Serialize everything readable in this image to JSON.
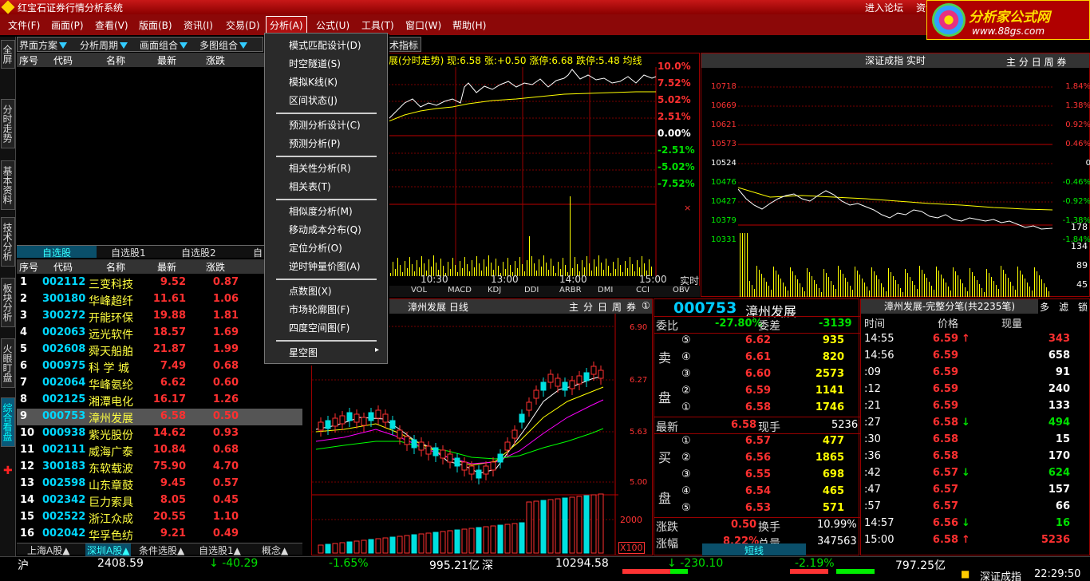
{
  "window": {
    "title": "红宝石证券行情分析系统"
  },
  "top_links": [
    "进入论坛",
    "资讯"
  ],
  "logo": {
    "brand": "分析家公式网",
    "url": "www.88gs.com"
  },
  "menu": [
    "文件(F)",
    "画面(P)",
    "查看(V)",
    "版面(B)",
    "资讯(I)",
    "交易(D)",
    "分析(A)",
    "公式(U)",
    "工具(T)",
    "窗口(W)",
    "帮助(H)"
  ],
  "toolbar": [
    "界面方案",
    "分析周期",
    "画面组合",
    "多图组合"
  ],
  "tech_label": "术指标",
  "left_rail": [
    "全屏",
    "分时走势",
    "基本资料",
    "技术分析",
    "板块分析",
    "火眼盯盘",
    "综合看盘"
  ],
  "upper_headers": [
    "序号",
    "代码",
    "名称",
    "最新",
    "涨跌"
  ],
  "upper_tabs": [
    "自选股",
    "自选股1",
    "自选股2",
    "自"
  ],
  "list_headers": [
    "序号",
    "代码",
    "名称",
    "最新",
    "涨跌"
  ],
  "stocks": [
    {
      "n": "1",
      "code": "002112",
      "name": "三变科技",
      "price": "9.52",
      "chg": "0.87"
    },
    {
      "n": "2",
      "code": "300180",
      "name": "华峰超纤",
      "price": "11.61",
      "chg": "1.06"
    },
    {
      "n": "3",
      "code": "300272",
      "name": "开能环保",
      "price": "19.88",
      "chg": "1.81"
    },
    {
      "n": "4",
      "code": "002063",
      "name": "远光软件",
      "price": "18.57",
      "chg": "1.69"
    },
    {
      "n": "5",
      "code": "002608",
      "name": "舜天船舶",
      "price": "21.87",
      "chg": "1.99"
    },
    {
      "n": "6",
      "code": "000975",
      "name": "科 学 城",
      "price": "7.49",
      "chg": "0.68"
    },
    {
      "n": "7",
      "code": "002064",
      "name": "华峰氨纶",
      "price": "6.62",
      "chg": "0.60"
    },
    {
      "n": "8",
      "code": "002125",
      "name": "湘潭电化",
      "price": "16.17",
      "chg": "1.26"
    },
    {
      "n": "9",
      "code": "000753",
      "name": "漳州发展",
      "price": "6.58",
      "chg": "0.50"
    },
    {
      "n": "10",
      "code": "000938",
      "name": "紫光股份",
      "price": "14.62",
      "chg": "0.93"
    },
    {
      "n": "11",
      "code": "002111",
      "name": "威海广泰",
      "price": "10.84",
      "chg": "0.68"
    },
    {
      "n": "12",
      "code": "300183",
      "name": "东软载波",
      "price": "75.90",
      "chg": "4.70"
    },
    {
      "n": "13",
      "code": "002598",
      "name": "山东章鼓",
      "price": "9.45",
      "chg": "0.57"
    },
    {
      "n": "14",
      "code": "002342",
      "name": "巨力索具",
      "price": "8.05",
      "chg": "0.45"
    },
    {
      "n": "15",
      "code": "002522",
      "name": "浙江众成",
      "price": "20.55",
      "chg": "1.10"
    },
    {
      "n": "16",
      "code": "002042",
      "name": "华孚色纺",
      "price": "9.21",
      "chg": "0.49"
    }
  ],
  "bottom_tabs": [
    "上海A股▲",
    "深圳A股▲",
    "条件选股▲",
    "自选股1▲",
    "概念▲"
  ],
  "dropdown": {
    "title": "分析(A)",
    "groups": [
      [
        "模式匹配设计(D)",
        "时空隧道(S)",
        "模拟K线(K)",
        "区间状态(J)"
      ],
      [
        "预测分析设计(C)",
        "预测分析(P)"
      ],
      [
        "相关性分析(R)",
        "相关表(T)"
      ],
      [
        "相似度分析(M)",
        "移动成本分布(Q)",
        "定位分析(O)",
        "逆时钟量价图(A)"
      ],
      [
        "点数图(X)",
        "市场轮廓图(F)",
        "四度空间图(F)"
      ],
      [
        "星空图"
      ]
    ]
  },
  "intraday": {
    "header": "展(分时走势) 现:6.58 张:+0.50 涨停:6.68 跌停:5.48 均线",
    "pct_labels": [
      "10.0%",
      "7.52%",
      "5.02%",
      "2.51%",
      "0.00%",
      "-2.51%",
      "-5.02%",
      "-7.52%"
    ],
    "indicators": [
      "VOL",
      "MACD",
      "KDJ",
      "DDI",
      "ARBR",
      "DMI",
      "CCI",
      "OBV"
    ],
    "times": [
      "10:30",
      "13:00",
      "14:00",
      "15:00"
    ],
    "realtime_label": "实时"
  },
  "index_chart": {
    "title": "深证成指 实时",
    "tabs": [
      "主",
      "分",
      "日",
      "周",
      "券"
    ],
    "price_ticks": [
      "10718",
      "10669",
      "10621",
      "10573",
      "10524",
      "10476",
      "10427",
      "10379",
      "10331"
    ],
    "pct_ticks": [
      "1.84%",
      "1.38%",
      "0.92%",
      "0.46%",
      "0",
      "-0.46%",
      "-0.92%",
      "-1.38%",
      "-1.84%"
    ],
    "vol_ticks": [
      "178",
      "134",
      "89",
      "45"
    ]
  },
  "kline": {
    "title": "漳州发展 日线",
    "tabs": [
      "主",
      "分",
      "日",
      "周",
      "券",
      "①"
    ],
    "price_ticks": [
      "6.90",
      "6.27",
      "5.63",
      "5.00"
    ],
    "vol_tick": "2000",
    "vol_unit": "X100"
  },
  "quote": {
    "code": "000753",
    "name": "漳州发展",
    "webi_label": "委比",
    "webi": "-27.80%",
    "wecha_label": "委差",
    "wecha": "-3139",
    "sell_label": [
      "卖",
      "盘"
    ],
    "buy_label": [
      "买",
      "盘"
    ],
    "sells": [
      {
        "lv": "⑤",
        "p": "6.62",
        "v": "935"
      },
      {
        "lv": "④",
        "p": "6.61",
        "v": "820"
      },
      {
        "lv": "③",
        "p": "6.60",
        "v": "2573"
      },
      {
        "lv": "②",
        "p": "6.59",
        "v": "1141"
      },
      {
        "lv": "①",
        "p": "6.58",
        "v": "1746"
      }
    ],
    "latest_label": "最新",
    "latest": "6.58",
    "xianshou_label": "现手",
    "xianshou": "5236",
    "buys": [
      {
        "lv": "①",
        "p": "6.57",
        "v": "477"
      },
      {
        "lv": "②",
        "p": "6.56",
        "v": "1865"
      },
      {
        "lv": "③",
        "p": "6.55",
        "v": "698"
      },
      {
        "lv": "④",
        "p": "6.54",
        "v": "465"
      },
      {
        "lv": "⑤",
        "p": "6.53",
        "v": "571"
      }
    ],
    "zhangdie_label": "涨跌",
    "zhangdie": "0.50",
    "huanshou_label": "换手",
    "huanshou": "10.99%",
    "zhangfu_label": "涨幅",
    "zhangfu": "8.22%",
    "zongliang_label": "总量",
    "zongliang": "347563",
    "tab_label": "短线"
  },
  "ticks": {
    "title": "漳州发展-完整分笔(共2235笔)",
    "tabs": [
      "多",
      "滤",
      "锁"
    ],
    "headers": [
      "时间",
      "价格",
      "现量"
    ],
    "rows": [
      {
        "t": "14:55",
        "p": "6.59",
        "v": "343",
        "arr": "↑",
        "c": "red"
      },
      {
        "t": "14:56",
        "p": "6.59",
        "v": "658",
        "arr": "",
        "c": "wht"
      },
      {
        "t": ":09",
        "p": "6.59",
        "v": "91",
        "arr": "",
        "c": "wht"
      },
      {
        "t": ":12",
        "p": "6.59",
        "v": "240",
        "arr": "",
        "c": "wht"
      },
      {
        "t": ":21",
        "p": "6.59",
        "v": "133",
        "arr": "",
        "c": "wht"
      },
      {
        "t": ":27",
        "p": "6.58",
        "v": "494",
        "arr": "↓",
        "c": "grn"
      },
      {
        "t": ":30",
        "p": "6.58",
        "v": "15",
        "arr": "",
        "c": "wht"
      },
      {
        "t": ":36",
        "p": "6.58",
        "v": "170",
        "arr": "",
        "c": "wht"
      },
      {
        "t": ":42",
        "p": "6.57",
        "v": "624",
        "arr": "↓",
        "c": "grn"
      },
      {
        "t": ":47",
        "p": "6.57",
        "v": "157",
        "arr": "",
        "c": "wht"
      },
      {
        "t": ":57",
        "p": "6.57",
        "v": "66",
        "arr": "",
        "c": "wht"
      },
      {
        "t": "14:57",
        "p": "6.56",
        "v": "16",
        "arr": "↓",
        "c": "grn"
      },
      {
        "t": "15:00",
        "p": "6.58",
        "v": "5236",
        "arr": "↑",
        "c": "red"
      }
    ]
  },
  "status": {
    "sh_label": "沪",
    "sh_idx": "2408.59",
    "sh_chg": "-40.29",
    "sh_pct": "-1.65%",
    "sh_amt": "995.21亿",
    "sz_label": "深",
    "sz_idx": "10294.58",
    "sz_chg": "-230.10",
    "sz_pct": "-2.19%",
    "sz_amt": "797.25亿",
    "index_name": "深证成指",
    "time": "22:29:50"
  }
}
